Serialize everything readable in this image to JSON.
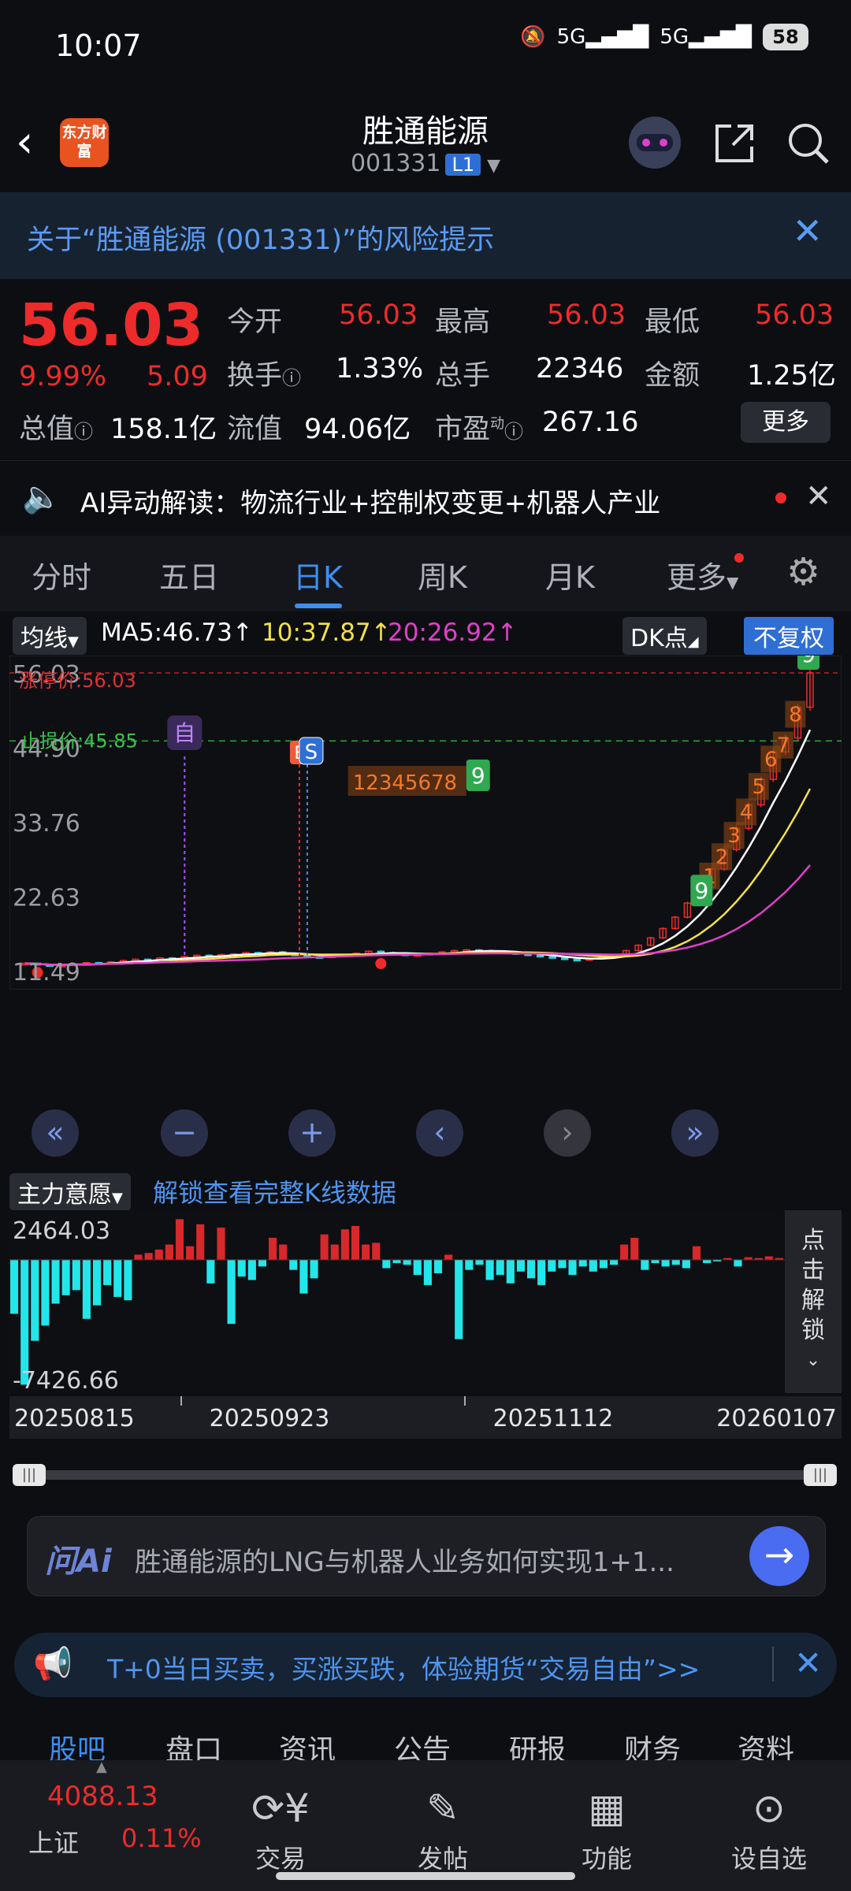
{
  "status_bar": {
    "time": "10:07",
    "net1": "5G",
    "net2": "5G",
    "battery": "58"
  },
  "header": {
    "logo_text": "东方财富",
    "stock_name": "胜通能源",
    "stock_code": "001331",
    "level_badge": "L1"
  },
  "risk_banner": {
    "text": "关于“胜通能源 (001331)”的风险提示"
  },
  "quote": {
    "price": "56.03",
    "change_pct": "9.99%",
    "change_amt": "5.09",
    "open_label": "今开",
    "open": "56.03",
    "high_label": "最高",
    "high": "56.03",
    "low_label": "最低",
    "low": "56.03",
    "turnover_label": "换手",
    "turnover": "1.33%",
    "volume_label": "总手",
    "volume": "22346",
    "amount_label": "金额",
    "amount": "1.25亿",
    "mktcap_label": "总值",
    "mktcap": "158.1亿",
    "float_label": "流值",
    "float": "94.06亿",
    "pe_label": "市盈",
    "pe_sup": "动",
    "pe": "267.16",
    "more_button": "更多"
  },
  "ai_line": {
    "text": "AI异动解读：物流行业+控制权变更+机器人产业"
  },
  "tabs": [
    {
      "label": "分时"
    },
    {
      "label": "五日"
    },
    {
      "label": "日K"
    },
    {
      "label": "周K"
    },
    {
      "label": "月K"
    },
    {
      "label": "更多"
    }
  ],
  "chart_controls": {
    "ma_select": "均线",
    "ma5": "MA5:46.73",
    "ma10": "10:37.87",
    "ma20": "20:26.92",
    "dk_select": "DK点",
    "fq_button": "不复权",
    "marker_zi": "自",
    "marker_s": "S",
    "marker_b": "B",
    "lower_select": "主力意愿",
    "unlock_link": "解锁查看完整K线数据",
    "unlock_side": "点击解锁"
  },
  "chart_data": [
    {
      "type": "candlestick",
      "y_ticks": [
        "56.03",
        "44.90",
        "33.76",
        "22.63",
        "11.49"
      ],
      "limit_up_label": "涨停价:56.03",
      "stop_label": "止损价:45.85",
      "ylim": [
        11.49,
        56.03
      ],
      "ma": [
        {
          "name": "MA5",
          "value": 46.73,
          "color": "#ffffff"
        },
        {
          "name": "MA10",
          "value": 37.87,
          "color": "#f2e04a"
        },
        {
          "name": "MA20",
          "value": 26.92,
          "color": "#e040c8"
        }
      ],
      "counts_mid": "12345678",
      "count_mid_end": "9",
      "counts_right": [
        "9",
        "8",
        "7",
        "6",
        "5",
        "4",
        "3",
        "2",
        "1"
      ],
      "count_green_right": "9",
      "close": [
        12.6,
        12.4,
        12.2,
        12.3,
        12.5,
        12.7,
        12.6,
        12.8,
        13.0,
        13.2,
        13.1,
        13.4,
        13.3,
        13.6,
        13.8,
        13.7,
        13.9,
        14.0,
        14.2,
        14.1,
        14.3,
        14.0,
        13.8,
        13.6,
        13.5,
        13.7,
        13.9,
        14.1,
        14.4,
        14.2,
        14.0,
        13.8,
        13.9,
        14.1,
        14.3,
        14.5,
        14.6,
        14.5,
        14.3,
        14.2,
        14.0,
        13.8,
        13.6,
        13.4,
        13.2,
        13.1,
        13.3,
        13.5,
        13.9,
        14.5,
        15.3,
        16.4,
        17.8,
        19.5,
        21.6,
        24.0,
        26.7,
        29.6,
        32.8,
        36.3,
        40.1,
        44.2,
        46.3,
        50.9,
        56.03
      ]
    },
    {
      "type": "bar",
      "name": "主力意愿",
      "y_ticks": [
        "2464.03",
        "-7426.66"
      ],
      "ylim": [
        -7426.66,
        2464.03
      ],
      "values": [
        -3200,
        -7400,
        -4800,
        -3900,
        -2600,
        -2100,
        -1800,
        -3500,
        -2700,
        -1500,
        -2200,
        -2400,
        300,
        400,
        600,
        900,
        2400,
        800,
        2100,
        -1400,
        1900,
        -3800,
        -1000,
        -1200,
        -400,
        1300,
        900,
        -600,
        -2000,
        -1100,
        1500,
        900,
        1800,
        2000,
        900,
        1000,
        -500,
        -200,
        -300,
        -900,
        -1500,
        -800,
        300,
        -4700,
        -600,
        -300,
        -1200,
        -900,
        -1400,
        -700,
        -1100,
        -1500,
        -700,
        -500,
        -900,
        -400,
        -700,
        -500,
        -300,
        900,
        1300,
        -600,
        -200,
        -400,
        -300,
        -500,
        800,
        -200,
        -100,
        100,
        -400,
        150,
        100,
        200,
        100
      ]
    },
    {
      "type": "axis",
      "x_ticks": [
        "20250815",
        "20250923",
        "20251112",
        "20260107"
      ]
    }
  ],
  "ask": {
    "logo": "问Ai",
    "question": "胜通能源的LNG与机器人业务如何实现1+1..."
  },
  "promo": {
    "text": "T+0当日买卖，买涨买跌，体验期货“交易自由”>>"
  },
  "sections": [
    "股吧",
    "盘口",
    "资讯",
    "公告",
    "研报",
    "财务",
    "资料"
  ],
  "bottom": {
    "index_value": "4088.13",
    "index_name": "上证",
    "index_change": "0.11%",
    "nav": [
      {
        "label": "交易",
        "icon": "trade-icon"
      },
      {
        "label": "发帖",
        "icon": "post-icon"
      },
      {
        "label": "功能",
        "icon": "apps-icon"
      },
      {
        "label": "设自选",
        "icon": "more-icon"
      }
    ]
  }
}
